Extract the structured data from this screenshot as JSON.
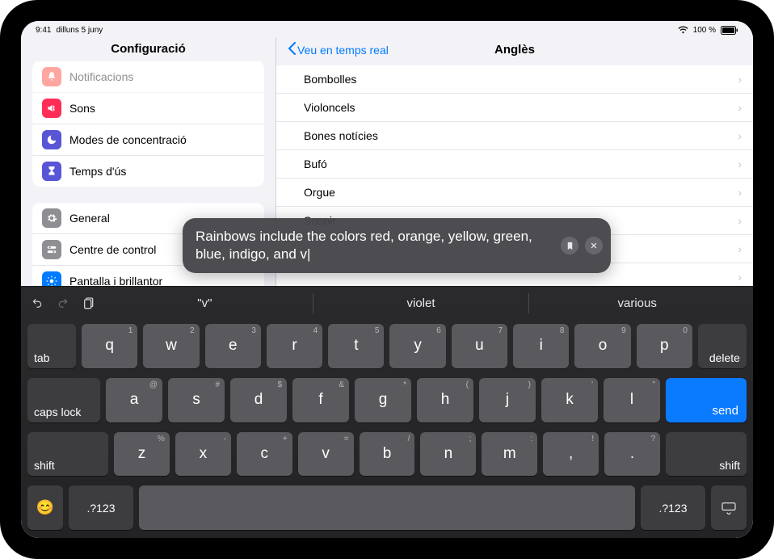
{
  "status": {
    "time": "9:41",
    "date": "dilluns 5 juny",
    "wifi": true,
    "battery_text": "100 %"
  },
  "sidebar": {
    "title": "Configuració",
    "group1": [
      {
        "label": "Notificacions",
        "icon": "bell",
        "color": "#ff3b30"
      },
      {
        "label": "Sons",
        "icon": "speaker",
        "color": "#ff2d55"
      },
      {
        "label": "Modes de concentració",
        "icon": "moon",
        "color": "#5856d6"
      },
      {
        "label": "Temps d'ús",
        "icon": "hourglass",
        "color": "#5856d6"
      }
    ],
    "group2": [
      {
        "label": "General",
        "icon": "gear",
        "color": "#8e8e93"
      },
      {
        "label": "Centre de control",
        "icon": "switches",
        "color": "#8e8e93"
      },
      {
        "label": "Pantalla i brillantor",
        "icon": "sun",
        "color": "#007aff"
      }
    ]
  },
  "detail": {
    "back": "Veu en temps real",
    "title": "Anglès",
    "items": [
      "Bombolles",
      "Violoncels",
      "Bones notícies",
      "Bufó",
      "Orgue",
      "Sospir"
    ]
  },
  "bubble": {
    "text": "Rainbows include the colors red, orange, yellow, green, blue, indigo, and v"
  },
  "keyboard": {
    "suggestions": [
      "\"v\"",
      "violet",
      "various"
    ],
    "row1": [
      {
        "main": "q",
        "alt": "1"
      },
      {
        "main": "w",
        "alt": "2"
      },
      {
        "main": "e",
        "alt": "3"
      },
      {
        "main": "r",
        "alt": "4"
      },
      {
        "main": "t",
        "alt": "5"
      },
      {
        "main": "y",
        "alt": "6"
      },
      {
        "main": "u",
        "alt": "7"
      },
      {
        "main": "i",
        "alt": "8"
      },
      {
        "main": "o",
        "alt": "9"
      },
      {
        "main": "p",
        "alt": "0"
      }
    ],
    "row2": [
      {
        "main": "a",
        "alt": "@"
      },
      {
        "main": "s",
        "alt": "#"
      },
      {
        "main": "d",
        "alt": "$"
      },
      {
        "main": "f",
        "alt": "&"
      },
      {
        "main": "g",
        "alt": "*"
      },
      {
        "main": "h",
        "alt": "("
      },
      {
        "main": "j",
        "alt": ")"
      },
      {
        "main": "k",
        "alt": "'"
      },
      {
        "main": "l",
        "alt": "\""
      }
    ],
    "row3": [
      {
        "main": "z",
        "alt": "%"
      },
      {
        "main": "x",
        "alt": "-"
      },
      {
        "main": "c",
        "alt": "+"
      },
      {
        "main": "v",
        "alt": "="
      },
      {
        "main": "b",
        "alt": "/"
      },
      {
        "main": "n",
        "alt": ";"
      },
      {
        "main": "m",
        "alt": ":"
      },
      {
        "main": ",",
        "alt": "!"
      },
      {
        "main": ".",
        "alt": "?"
      }
    ],
    "tab": "tab",
    "delete": "delete",
    "caps": "caps lock",
    "send": "send",
    "shift": "shift",
    "numbers": ".?123"
  }
}
